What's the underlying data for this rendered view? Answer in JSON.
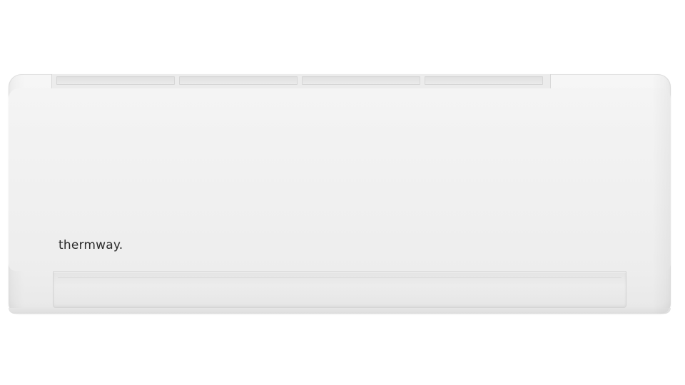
{
  "product": {
    "type": "wall-mounted split air conditioner indoor unit",
    "brand": {
      "logo_text": "thermway."
    },
    "colors": {
      "body": "#f1f1f1",
      "louver": "#e8e8e8",
      "logo": "#2b2b2b",
      "background": "#ffffff"
    },
    "top_grille": {
      "slot_count": 4
    }
  }
}
